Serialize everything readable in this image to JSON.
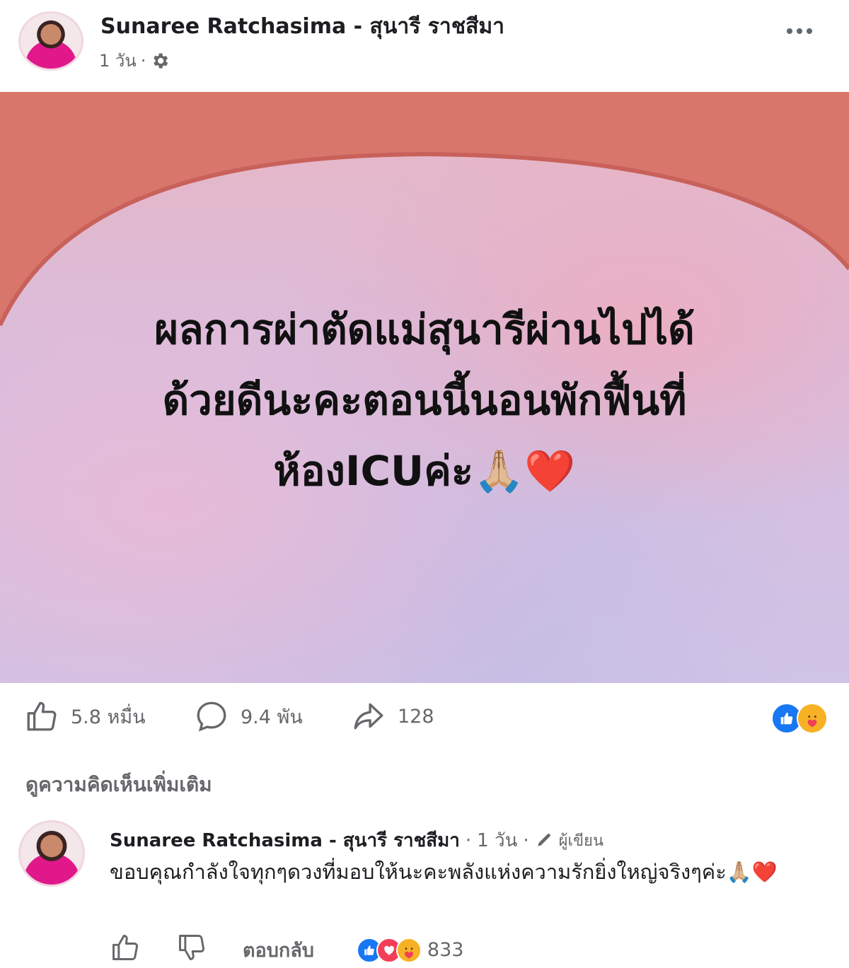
{
  "post": {
    "author": "Sunaree Ratchasima - สุนารี ราชสีมา",
    "time": "1 วัน",
    "separator": "·",
    "image_text_line1": "ผลการผ่าตัดแม่สุนารีผ่านไปได้",
    "image_text_line2": "ด้วยดีนะคะตอนนี้นอนพักฟื้นที่",
    "image_text_line3": "ห้องICUค่ะ🙏🏼❤️"
  },
  "stats": {
    "likes": "5.8 หมื่น",
    "comments": "9.4 พัน",
    "shares": "128"
  },
  "reactions": [
    "like-icon",
    "care-icon"
  ],
  "view_more_comments": "ดูความคิดเห็นเพิ่มเติม",
  "comment": {
    "author": "Sunaree Ratchasima - สุนารี ราชสีมา",
    "time": "1 วัน",
    "badge": "ผู้เขียน",
    "text": "ขอบคุณกำลังใจทุกๆดวงที่มอบให้นะคะพลังแห่งความรักยิ่งใหญ่จริงๆค่ะ🙏🏼❤️",
    "reply_label": "ตอบกลับ",
    "reaction_count": "833"
  },
  "colors": {
    "like_blue": "#1877f2",
    "love_red": "#f33e58",
    "care_yellow": "#f7b125",
    "arch": "#d8746a"
  }
}
